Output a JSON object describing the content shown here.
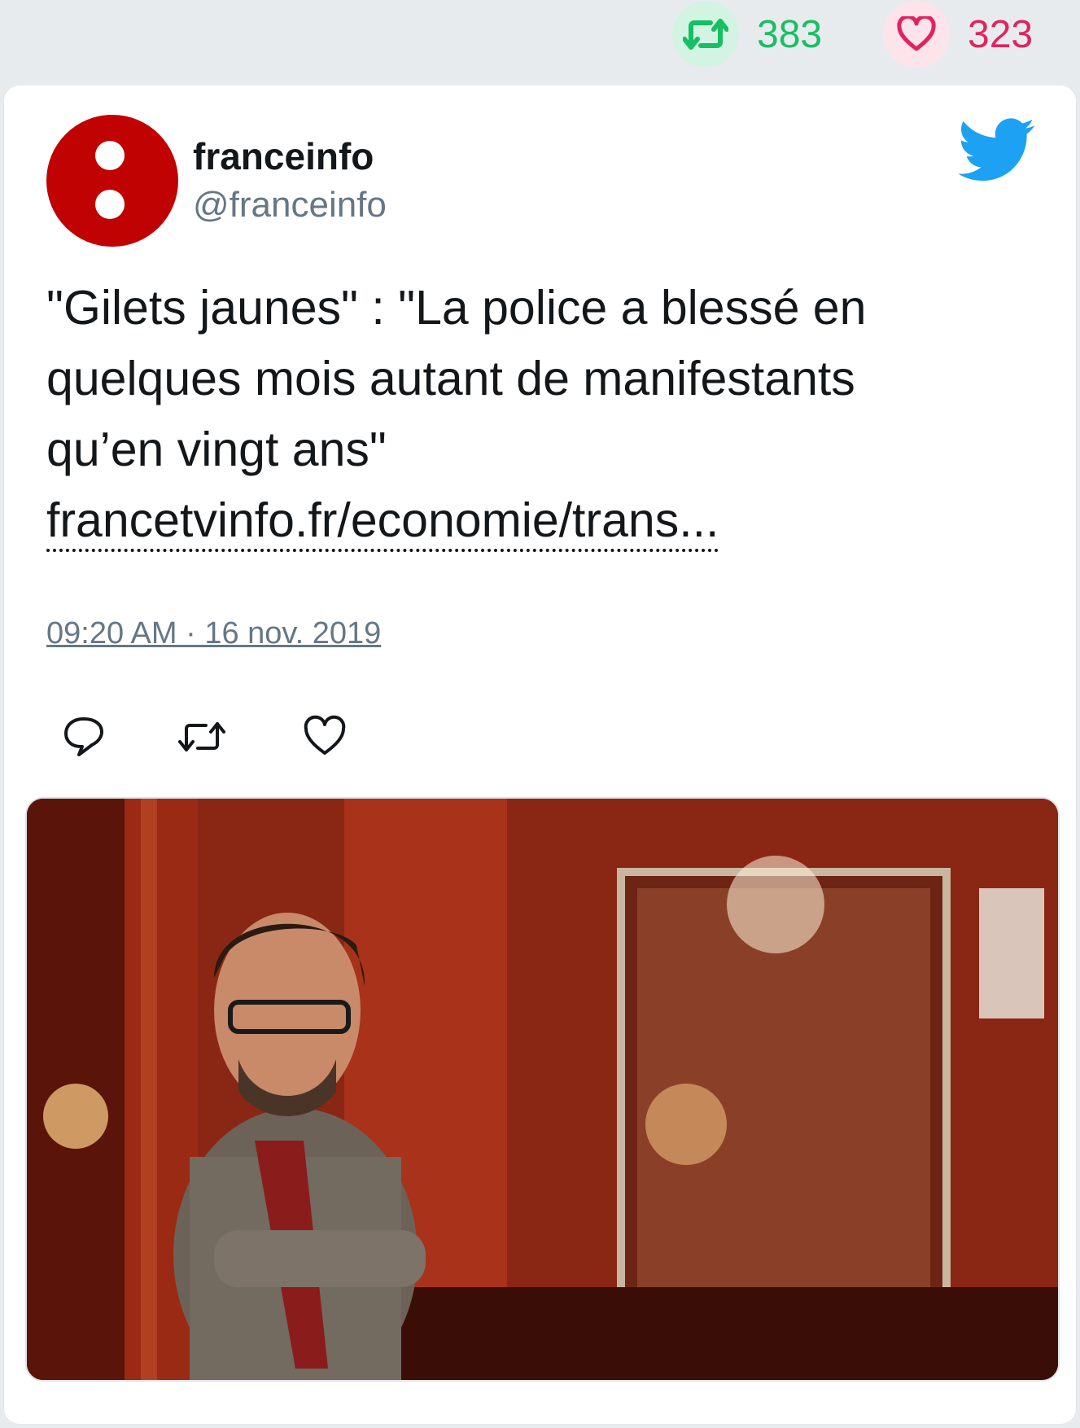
{
  "stats": {
    "retweets": "383",
    "likes": "323",
    "retweet_icon": "retweet-icon",
    "like_icon": "heart-icon"
  },
  "tweet": {
    "display_name": "franceinfo",
    "handle": "@franceinfo",
    "text_lines": [
      "\"Gilets jaunes\" : \"La police a blessé en",
      "quelques mois autant de manifestants",
      "qu’en vingt ans\""
    ],
    "link": "francetvinfo.fr/economie/trans...",
    "timestamp": "09:20 AM · 16 nov. 2019"
  },
  "actions": {
    "reply_icon": "reply-icon",
    "retweet_icon": "retweet-icon",
    "like_icon": "heart-icon"
  },
  "media": {
    "description_icon": "photo"
  },
  "colors": {
    "retweet_green": "#17bf63",
    "like_red": "#e0245e",
    "twitter_blue": "#1da1f2",
    "franceinfo_red": "#c00202",
    "secondary_text": "#657786"
  }
}
